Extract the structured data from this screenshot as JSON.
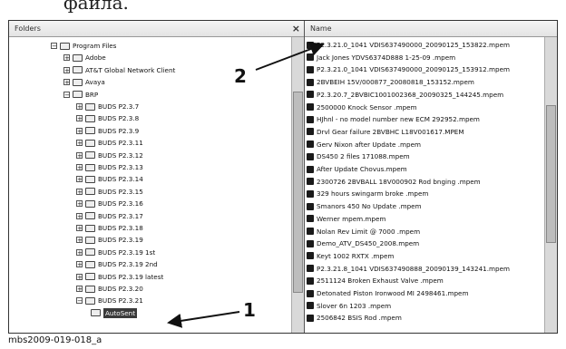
{
  "top_text": "файла.",
  "left_pane": {
    "header": "Folders",
    "close_glyph": "×",
    "tree": [
      {
        "label": "Program Files",
        "indent": 0,
        "exp": "−"
      },
      {
        "label": "Adobe",
        "indent": 1,
        "exp": "+"
      },
      {
        "label": "AT&T Global Network Client",
        "indent": 1,
        "exp": "+"
      },
      {
        "label": "Avaya",
        "indent": 1,
        "exp": "+"
      },
      {
        "label": "BRP",
        "indent": 1,
        "exp": "−"
      },
      {
        "label": "BUDS P2.3.7",
        "indent": 2,
        "exp": "+"
      },
      {
        "label": "BUDS P2.3.8",
        "indent": 2,
        "exp": "+"
      },
      {
        "label": "BUDS P2.3.9",
        "indent": 2,
        "exp": "+"
      },
      {
        "label": "BUDS P2.3.11",
        "indent": 2,
        "exp": "+"
      },
      {
        "label": "BUDS P2.3.12",
        "indent": 2,
        "exp": "+"
      },
      {
        "label": "BUDS P2.3.13",
        "indent": 2,
        "exp": "+"
      },
      {
        "label": "BUDS P2.3.14",
        "indent": 2,
        "exp": "+"
      },
      {
        "label": "BUDS P2.3.15",
        "indent": 2,
        "exp": "+"
      },
      {
        "label": "BUDS P2.3.16",
        "indent": 2,
        "exp": "+"
      },
      {
        "label": "BUDS P2.3.17",
        "indent": 2,
        "exp": "+"
      },
      {
        "label": "BUDS P2.3.18",
        "indent": 2,
        "exp": "+"
      },
      {
        "label": "BUDS P2.3.19",
        "indent": 2,
        "exp": "+"
      },
      {
        "label": "BUDS P2.3.19 1st",
        "indent": 2,
        "exp": "+"
      },
      {
        "label": "BUDS P2.3.19 2nd",
        "indent": 2,
        "exp": "+"
      },
      {
        "label": "BUDS P2.3.19 latest",
        "indent": 2,
        "exp": "+"
      },
      {
        "label": "BUDS P2.3.20",
        "indent": 2,
        "exp": "+"
      },
      {
        "label": "BUDS P2.3.21",
        "indent": 2,
        "exp": "−"
      },
      {
        "label": "AutoSent",
        "indent": 3,
        "exp": "",
        "selected": true
      }
    ]
  },
  "right_pane": {
    "header": "Name",
    "files": [
      "P2.3.21.0_1041 VDIS637490000_20090125_153822.mpem",
      "Jack Jones YDVS6374D888 1-25-09 .mpem",
      "P2.3.21.0_1041 VDIS637490000_20090125_153912.mpem",
      "2BVBEIH 15V/000877_20080818_153152.mpem",
      "P2.3.20.7_2BVBIC1001002368_20090325_144245.mpem",
      "2500000 Knock Sensor .mpem",
      "HJhnl - no model number new ECM 292952.mpem",
      "Drvl Gear failure 2BVBHC L18V001617.MPEM",
      "Gerv Nixon after Update .mpem",
      "DS450 2 files 171088.mpem",
      "After Update Chovus.mpem",
      "2300726 2BVBALL 18V000902 Rod bnging .mpem",
      "329 hours swingarm broke .mpem",
      "Smanors 450 No Update .mpem",
      "Werner mpem.mpem",
      "Nolan Rev Limit @ 7000 .mpem",
      "Demo_ATV_DS450_2008.mpem",
      "Keyt 1002 RXTX .mpem",
      "P2.3.21.8_1041 VDIS637490888_20090139_143241.mpem",
      "2511124 Broken Exhaust Valve .mpem",
      "Detonated Piston Ironwood MI 2498461.mpem",
      "Slover 6n 1203 .mpem",
      "2506842 BSIS Rod .mpem"
    ]
  },
  "callouts": {
    "one": "1",
    "two": "2"
  },
  "caption": "mbs2009-019-018_a"
}
